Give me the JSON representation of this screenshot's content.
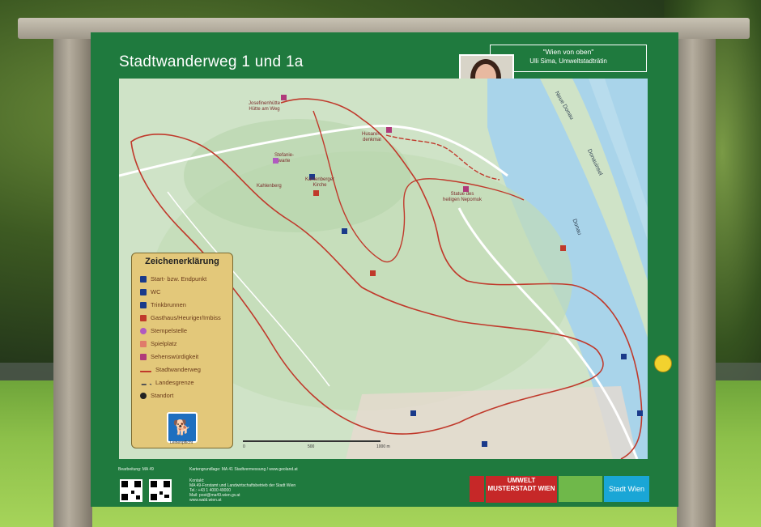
{
  "sign": {
    "title": "Stadtwanderweg 1 und 1a",
    "quote_line1": "\"Wien von oben\"",
    "quote_line2": "Ulli Sima, Umweltstadträtin"
  },
  "legend": {
    "title": "Zeichenerklärung",
    "items": [
      {
        "label": "Start- bzw. Endpunkt",
        "icon": "start-flag-icon",
        "color": "#1a3a8a"
      },
      {
        "label": "WC",
        "icon": "wc-icon",
        "color": "#1a3a8a"
      },
      {
        "label": "Trinkbrunnen",
        "icon": "fountain-icon",
        "color": "#1a3a8a"
      },
      {
        "label": "Gasthaus/Heuriger/Imbiss",
        "icon": "restaurant-icon",
        "color": "#c0392b"
      },
      {
        "label": "Stempelstelle",
        "icon": "stamp-icon",
        "color": "#b05ac0"
      },
      {
        "label": "Spielplatz",
        "icon": "playground-icon",
        "color": "#e07a6a"
      },
      {
        "label": "Sehenswürdigkeit",
        "icon": "sight-icon",
        "color": "#b03a7a"
      },
      {
        "label": "Stadtwanderweg",
        "icon": "trail-line-icon",
        "color": "#c0392b"
      },
      {
        "label": "Landesgrenze",
        "icon": "border-line-icon",
        "color": "#555555"
      },
      {
        "label": "Standort",
        "icon": "location-icon",
        "color": "#222222"
      }
    ],
    "dog_label": "Leinenpflicht"
  },
  "map": {
    "places": [
      {
        "text": "Josefinenhütte\nHütte am Weg"
      },
      {
        "text": "Stefanie-\nwarte"
      },
      {
        "text": "Kahlenberger\nKirche"
      },
      {
        "text": "Husaren-\ndenkmal"
      },
      {
        "text": "Statue des\nheiligen Nepomuk"
      },
      {
        "text": "Kahlenberg"
      }
    ],
    "rivers": [
      "Neue Donau",
      "Donauinsel",
      "Donau"
    ],
    "scale": [
      "0",
      "500",
      "1000 m"
    ]
  },
  "footer": {
    "editor": "Bearbeitung: MA 49",
    "basemap": "Kartengrundlage: MA 41 Stadtvermessung / www.geoland.at",
    "contact_title": "Kontakt:",
    "contact_org": "MA 49-Forstamt und Landwirtschaftsbetrieb der Stadt Wien",
    "contact_tel": "Tel.: +43 1 4000 49000",
    "contact_mail": "Mail: post@ma49.wien.gv.at",
    "contact_web": "www.wald.wien.at",
    "logo_umwelt": "UMWELT MUSTERSTADT WIEN",
    "logo_stadt": "Stadt Wien"
  },
  "colors": {
    "board": "#1f7a3e",
    "trail": "#c0392b",
    "legend_bg": "#e3c87a",
    "water": "#a9d4ea"
  }
}
